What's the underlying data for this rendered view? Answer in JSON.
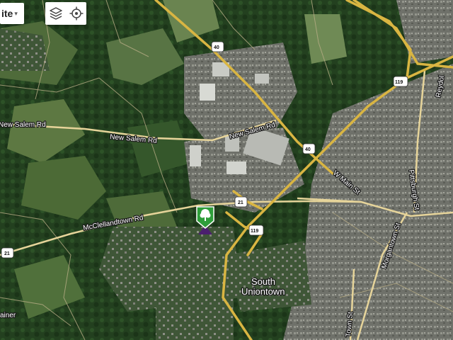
{
  "map_type_control": {
    "label": "ite",
    "caret": "▾"
  },
  "toolbar": {
    "layers_icon": "layers-icon",
    "locate_icon": "crosshair-locate-icon"
  },
  "marker": {
    "icon": "tree-icon",
    "color": "#2e9e3a"
  },
  "roads": {
    "new_salem_rd_west": "New Salem Rd",
    "new_salem_rd": "New Salem Rd",
    "mcclellandtown_rd": "McClellandtown Rd",
    "w_main_st": "W Main St",
    "pittsburgh_st": "Pittsburgh St",
    "morgantown_st": "Morgantown St",
    "town_st": "Town St",
    "reydolds_st": "Reydol"
  },
  "shields": {
    "us40_north": "40",
    "us40_south": "40",
    "us119_ne": "119",
    "us119_center": "119",
    "pa21_center": "21",
    "pa21_west": "21"
  },
  "places": {
    "south_uniontown_line1": "South",
    "south_uniontown_line2": "Uniontown"
  },
  "edge_label": "ainer",
  "colors": {
    "highway": "#d9b542",
    "road": "#e6d49a",
    "vegetation": "#2a4a24",
    "urban": "#7c7d74"
  }
}
